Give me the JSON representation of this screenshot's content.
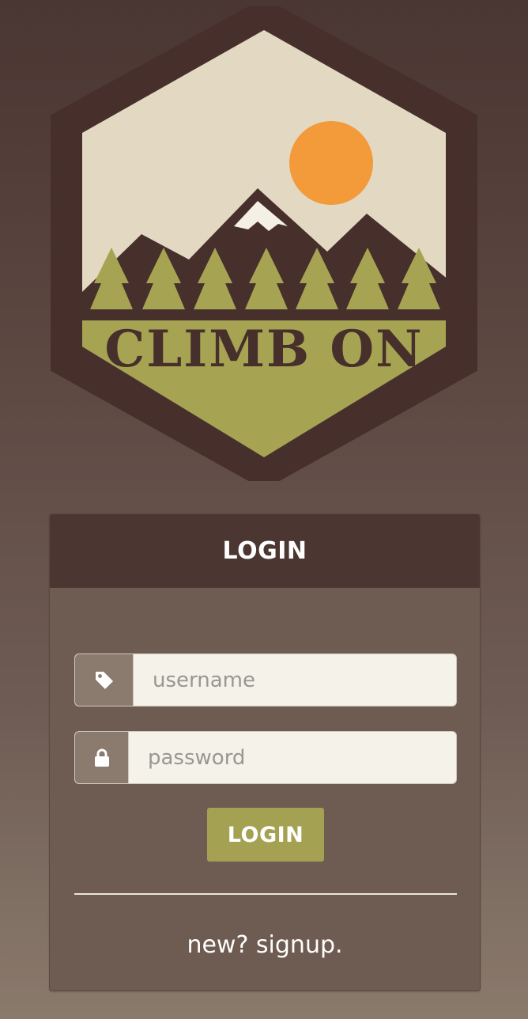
{
  "logo": {
    "text": "CLIMB ON",
    "colors": {
      "outline": "#472f2c",
      "sky": "#e3d9c3",
      "sun": "#f39a3b",
      "mountain": "#472f2c",
      "snow": "#f5f0e6",
      "trees": "#a6a353",
      "ground": "#a6a353"
    }
  },
  "panel": {
    "title": "LOGIN"
  },
  "form": {
    "username": {
      "placeholder": "username",
      "icon": "tag-icon"
    },
    "password": {
      "placeholder": "password",
      "icon": "lock-icon"
    },
    "submit_label": "LOGIN",
    "signup_text": "new? signup."
  },
  "colors": {
    "panel_header": "#4b3632",
    "panel_body": "#6e5b51",
    "button": "#a4a153",
    "input_background": "#f5f2ea",
    "addon_background": "#8b7a6e"
  }
}
